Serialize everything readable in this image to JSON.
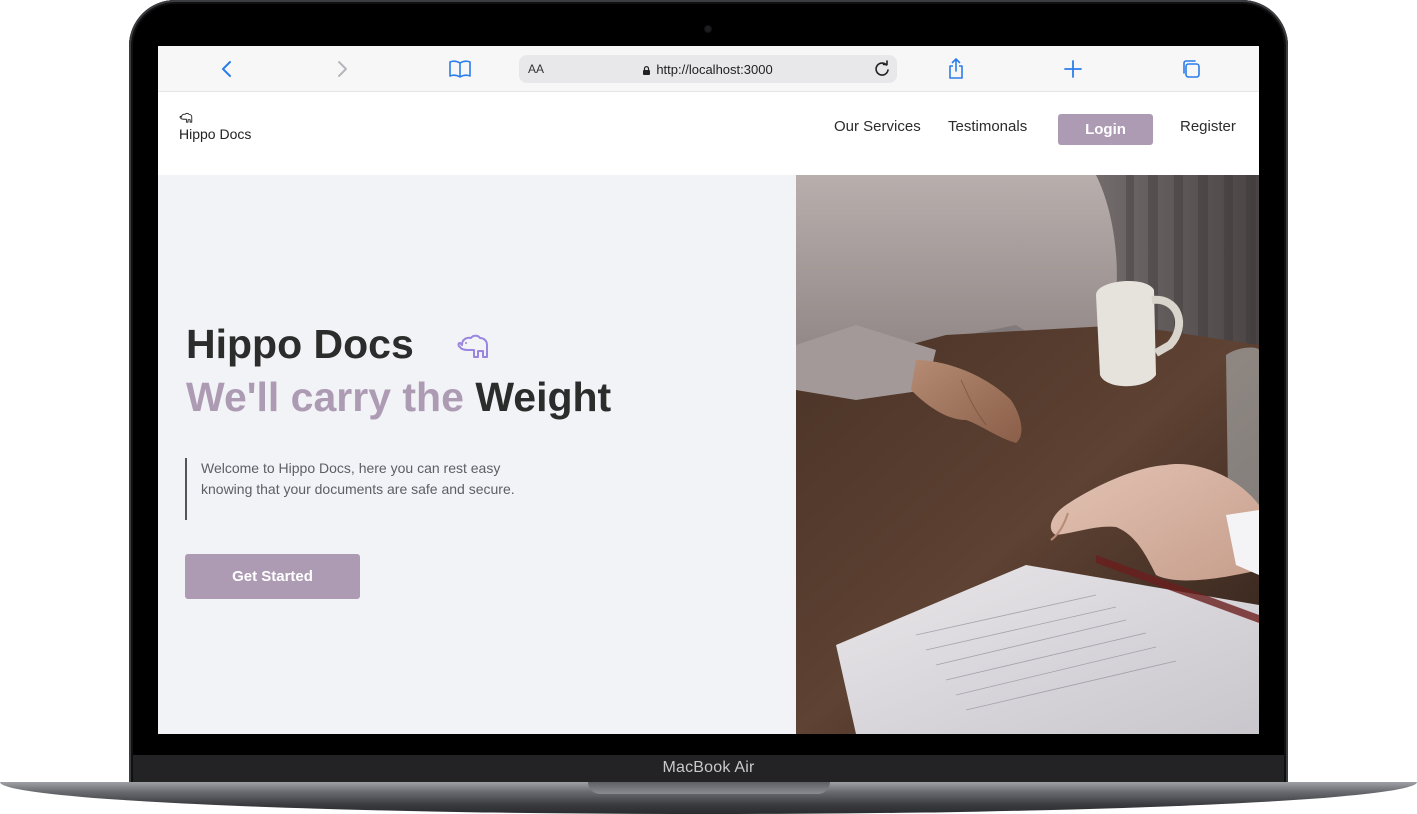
{
  "device": {
    "label": "MacBook Air"
  },
  "browser": {
    "text_size_label": "AA",
    "url": "http://localhost:3000",
    "icons": [
      "back-icon",
      "forward-icon",
      "bookmarks-icon",
      "lock-icon",
      "reload-icon",
      "share-icon",
      "new-tab-icon",
      "tabs-icon"
    ]
  },
  "nav": {
    "brand": "Hippo Docs",
    "links": [
      "Our Services",
      "Testimonals"
    ],
    "login": "Login",
    "register": "Register"
  },
  "hero": {
    "title": "Hippo Docs",
    "headline_accent": "We'll carry the",
    "headline_dark": "Weight",
    "description": "Welcome to Hippo Docs, here you can rest easy knowing that your documents are safe and secure.",
    "cta": "Get Started"
  },
  "colors": {
    "accent": "#ad9bb4",
    "hero_bg": "#f2f3f6",
    "text_dark": "#2c2c2c",
    "icon_blue": "#2b7de9"
  }
}
